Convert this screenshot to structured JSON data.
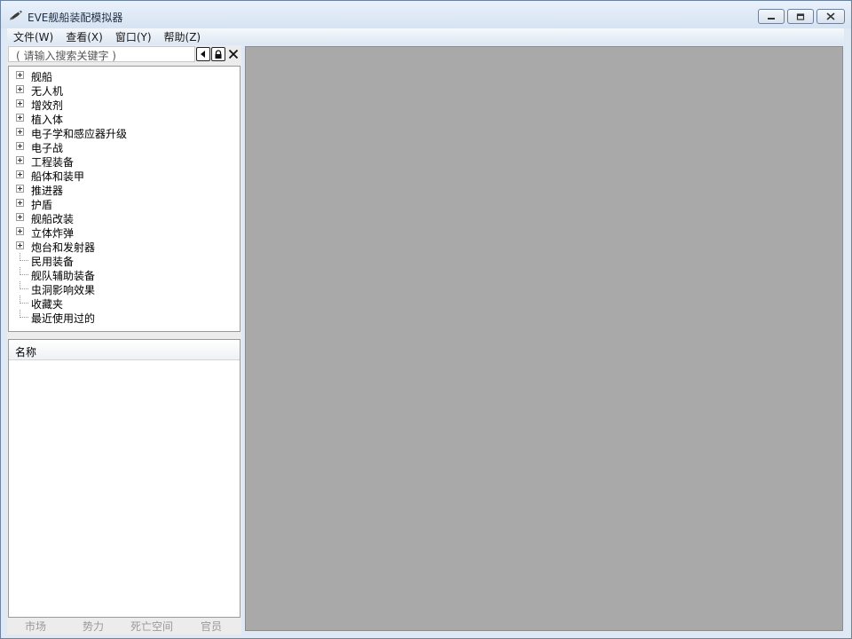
{
  "window": {
    "title": "EVE舰船装配模拟器"
  },
  "menu": [
    {
      "label": "文件(W)"
    },
    {
      "label": "查看(X)"
    },
    {
      "label": "窗口(Y)"
    },
    {
      "label": "帮助(Z)"
    }
  ],
  "search": {
    "placeholder": "( 请输入搜索关键字 )"
  },
  "tree": [
    {
      "label": "舰船",
      "expandable": true
    },
    {
      "label": "无人机",
      "expandable": true
    },
    {
      "label": "增效剂",
      "expandable": true
    },
    {
      "label": "植入体",
      "expandable": true
    },
    {
      "label": "电子学和感应器升级",
      "expandable": true
    },
    {
      "label": "电子战",
      "expandable": true
    },
    {
      "label": "工程装备",
      "expandable": true
    },
    {
      "label": "船体和装甲",
      "expandable": true
    },
    {
      "label": "推进器",
      "expandable": true
    },
    {
      "label": "护盾",
      "expandable": true
    },
    {
      "label": "舰船改装",
      "expandable": true
    },
    {
      "label": "立体炸弹",
      "expandable": true
    },
    {
      "label": "炮台和发射器",
      "expandable": true
    },
    {
      "label": "民用装备",
      "expandable": false
    },
    {
      "label": "舰队辅助装备",
      "expandable": false
    },
    {
      "label": "虫洞影响效果",
      "expandable": false
    },
    {
      "label": "收藏夹",
      "expandable": false
    },
    {
      "label": "最近使用过的",
      "expandable": false
    }
  ],
  "list": {
    "header": "名称"
  },
  "bottom_tabs": [
    {
      "label": "市场"
    },
    {
      "label": "势力"
    },
    {
      "label": "死亡空间"
    },
    {
      "label": "官员"
    }
  ],
  "icons": {
    "app": "eve-ship-icon",
    "minimize": "minimize-icon",
    "maximize": "maximize-icon",
    "close": "close-icon"
  }
}
